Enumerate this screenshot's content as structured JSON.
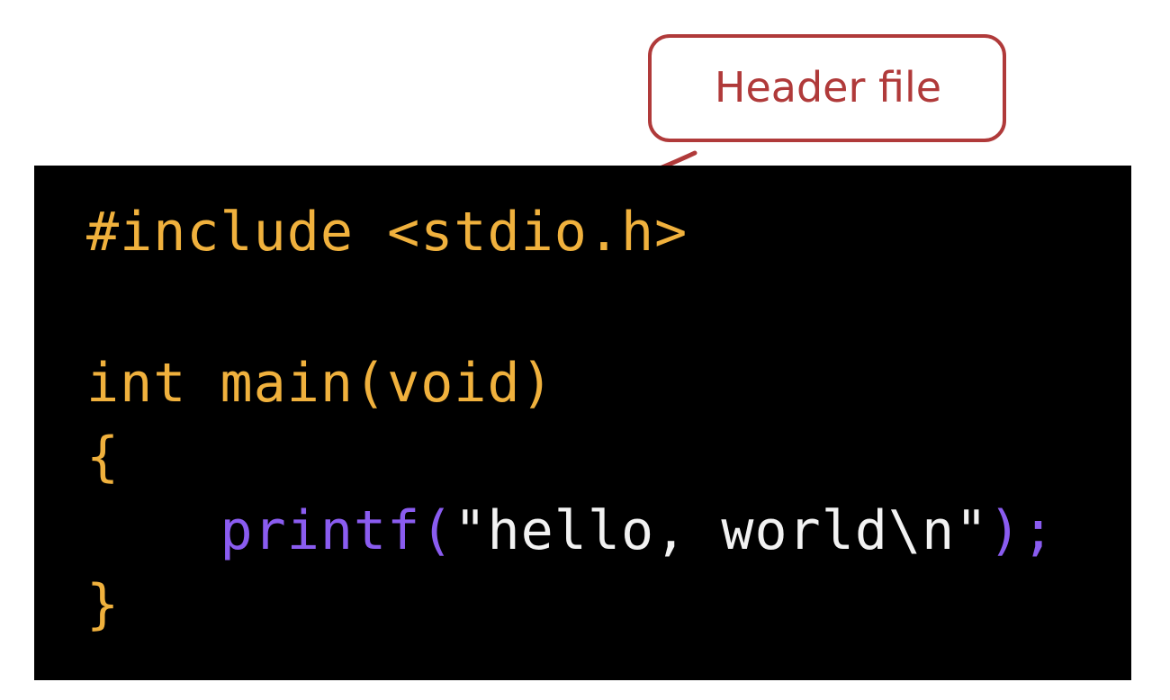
{
  "callout": {
    "label": "Header file"
  },
  "code": {
    "include_directive": "#include",
    "include_header": "<stdio.h>",
    "main_type": "int",
    "main_signature": "main(void)",
    "open_brace": "{",
    "indent": "    ",
    "call_name": "printf",
    "call_open": "(",
    "call_string": "\"hello, world\\n\"",
    "call_close": ");",
    "close_brace": "}"
  },
  "colors": {
    "code_background": "#000000",
    "keyword_orange": "#f0b13d",
    "function_purple": "#8a5cf0",
    "string_white": "#f2f2f2",
    "annotation_red": "#b03a3a"
  }
}
